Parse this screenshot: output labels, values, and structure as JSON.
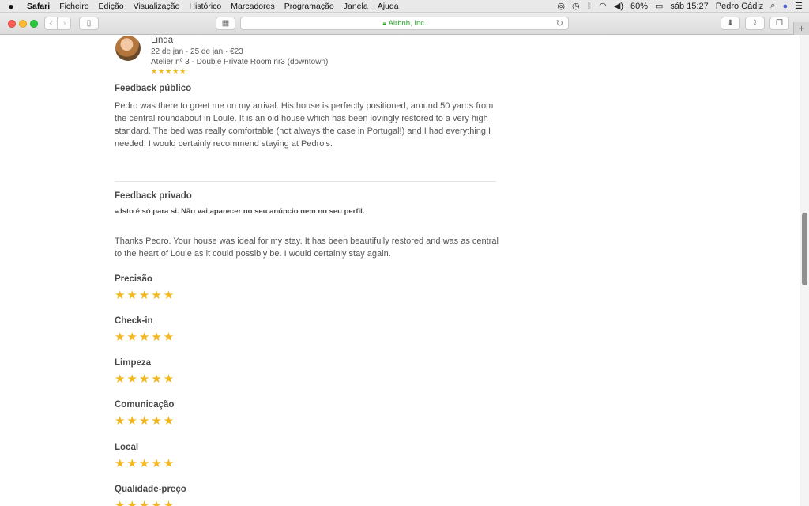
{
  "menubar": {
    "items": [
      "Safari",
      "Ficheiro",
      "Edição",
      "Visualização",
      "Histórico",
      "Marcadores",
      "Programação",
      "Janela",
      "Ajuda"
    ],
    "battery": "60%",
    "clock": "sáb 15:27",
    "user": "Pedro Cádiz"
  },
  "toolbar": {
    "address": "Airbnb, Inc."
  },
  "review": {
    "name": "Linda",
    "dates": "22 de jan - 25 de jan · €23",
    "listing": "Atelier nº 3 - Double Private Room nr3 (downtown)",
    "stars": "★★★★★",
    "public_title": "Feedback público",
    "public_text": "Pedro was there to greet me on my arrival. His house is perfectly positioned, around 50 yards from the central roundabout in Loule. It is an old house which has been lovingly restored to a very high standard. The bed was really comfortable (not always the case in Portugal!) and I had everything I needed. I would certainly recommend staying at Pedro's.",
    "private_title": "Feedback privado",
    "private_note": "Isto é só para si. Não vai aparecer no seu anúncio nem no seu perfil.",
    "private_text": "Thanks Pedro. Your house was ideal for my stay. It has been beautifully restored and was as central to the heart of Loule as it could possibly be. I would certainly stay again."
  },
  "ratings": [
    {
      "label": "Precisão",
      "stars": "★★★★★",
      "value": 5
    },
    {
      "label": "Check-in",
      "stars": "★★★★★",
      "value": 5
    },
    {
      "label": "Limpeza",
      "stars": "★★★★★",
      "value": 5
    },
    {
      "label": "Comunicação",
      "stars": "★★★★★",
      "value": 5
    },
    {
      "label": "Local",
      "stars": "★★★★★",
      "value": 5
    },
    {
      "label": "Qualidade-preço",
      "stars": "★★★★★",
      "value": 5
    }
  ],
  "colors": {
    "star": "#f3b71d",
    "secure_url": "#2aa52a"
  }
}
